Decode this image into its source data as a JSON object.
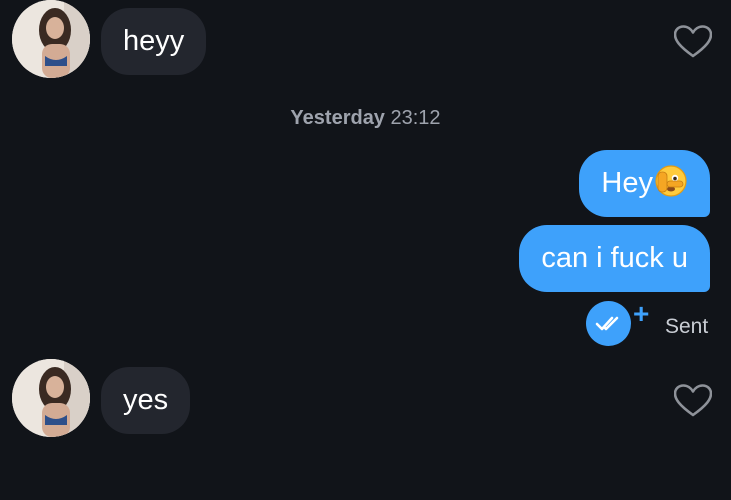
{
  "messages": [
    {
      "direction": "incoming",
      "text": "heyy",
      "liked": false,
      "avatar_icon": "profile-photo"
    },
    {
      "direction": "outgoing",
      "text": "Hey",
      "emoji": "face-with-peeking-eye-emoji"
    },
    {
      "direction": "outgoing",
      "text": "can i fuck u"
    },
    {
      "direction": "incoming",
      "text": "yes",
      "liked": false,
      "avatar_icon": "profile-photo"
    }
  ],
  "timestamp": {
    "day": "Yesterday",
    "time": "23:12"
  },
  "receipt": {
    "status": "Sent",
    "check_icon": "double-check-icon",
    "plus_icon": "plus-icon"
  },
  "colors": {
    "background": "#111419",
    "incoming_bubble": "#23262e",
    "outgoing_bubble": "#3ea1fb",
    "timestamp_text": "#9ea3ad",
    "heart_outline": "#8e9299"
  }
}
